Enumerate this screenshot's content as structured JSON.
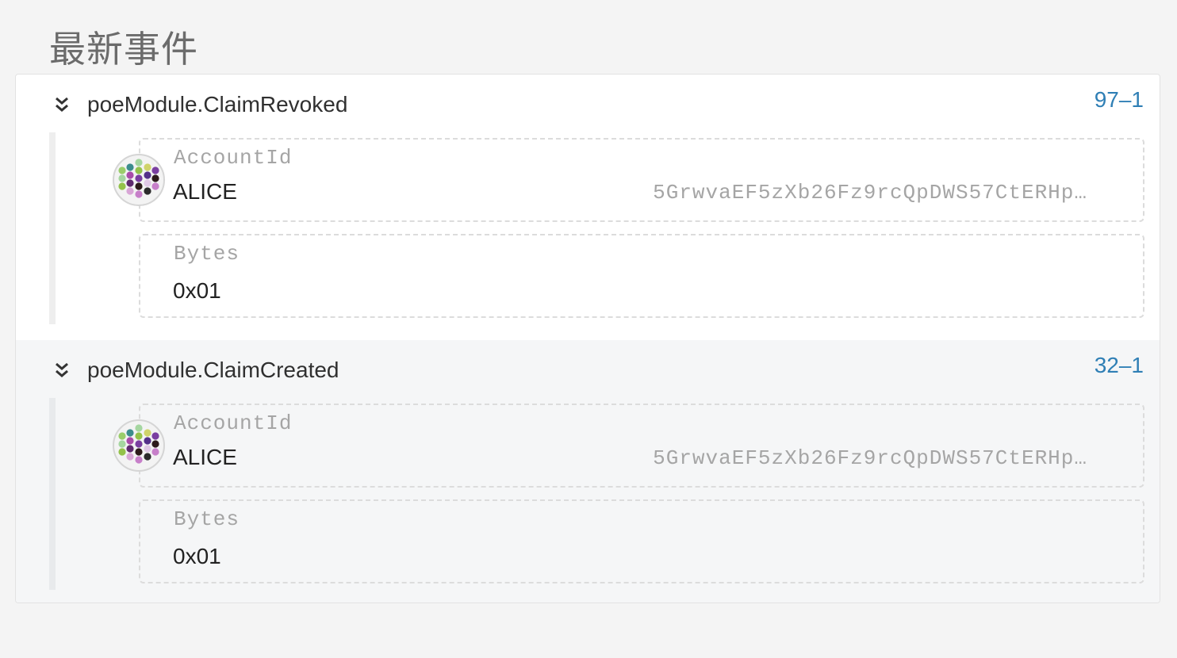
{
  "section": {
    "title": "最新事件"
  },
  "events": [
    {
      "name": "poeModule.ClaimRevoked",
      "link": "97–1",
      "params": {
        "account_label": "AccountId",
        "account_name": "ALICE",
        "account_address": "5GrwvaEF5zXb26Fz9rcQpDWS57CtERHp…",
        "bytes_label": "Bytes",
        "bytes_value": "0x01"
      }
    },
    {
      "name": "poeModule.ClaimCreated",
      "link": "32–1",
      "params": {
        "account_label": "AccountId",
        "account_name": "ALICE",
        "account_address": "5GrwvaEF5zXb26Fz9rcQpDWS57CtERHp…",
        "bytes_label": "Bytes",
        "bytes_value": "0x01"
      }
    }
  ],
  "icons": {
    "expand": "double-chevron-down-icon",
    "identicon": "polkadot-identicon"
  },
  "colors": {
    "link": "#2f7fb5",
    "identicon_dots": [
      "#a5d6a0",
      "#93c24a",
      "#7a3ea0",
      "#2c1a1a",
      "#c77fc9",
      "#3b8c8c",
      "#a84ca8",
      "#5e2a6e",
      "#d8a6d6",
      "#cfd36a",
      "#54308a",
      "#e0c9e6",
      "#2b2b2b",
      "#9acd6a"
    ]
  }
}
